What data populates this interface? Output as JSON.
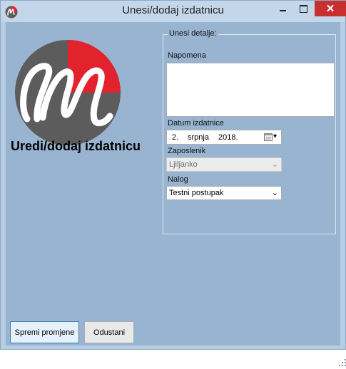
{
  "window": {
    "title": "Unesi/dodaj izdatnicu",
    "close_glyph": "✕"
  },
  "form": {
    "title": "Uredi/dodaj izdatnicu",
    "group_label": "Unesi detalje:"
  },
  "fields": {
    "napomena": {
      "label": "Napomena",
      "value": ""
    },
    "datum": {
      "label": "Datum izdatnice",
      "day": "2.",
      "month": "srpnja",
      "year": "2018.",
      "arrow": "▾"
    },
    "zaposlenik": {
      "label": "Zaposlenik",
      "value": "Ljiljanko",
      "arrow": "⌄"
    },
    "nalog": {
      "label": "Nalog",
      "value": "Testni postupak",
      "arrow": "⌄"
    }
  },
  "buttons": {
    "save": "Spremi promjene",
    "cancel": "Odustani"
  },
  "icons": {
    "app": "m-logo-icon",
    "calendar": "calendar-icon",
    "minimize": "minimize-icon",
    "maximize": "maximize-icon",
    "close": "close-icon",
    "resize": "resize-grip-icon"
  },
  "colors": {
    "client_bg": "#99b4d1",
    "logo_red": "#e2232d",
    "logo_gray": "#5c5c5c",
    "close_btn": "#c7302f"
  }
}
